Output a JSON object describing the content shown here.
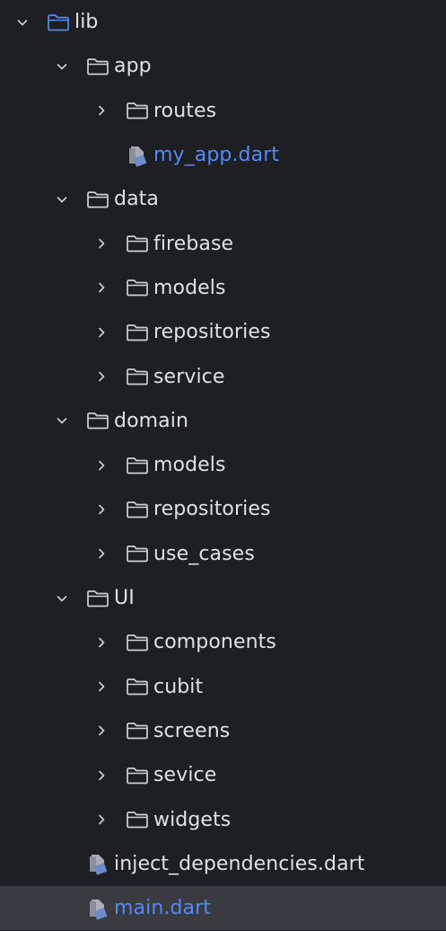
{
  "colors": {
    "background": "#1e1f22",
    "text": "#dfe1e5",
    "accent_blue": "#548af7",
    "folder_outline": "#ced0d6",
    "selected_row": "#393b40",
    "dart_icon": "#6c8cc8"
  },
  "tree": {
    "rows": [
      {
        "label": "lib",
        "type": "folder",
        "expanded": true,
        "depth": 0,
        "icon": "folder-icon",
        "highlight": true
      },
      {
        "label": "app",
        "type": "folder",
        "expanded": true,
        "depth": 1,
        "icon": "folder-icon"
      },
      {
        "label": "routes",
        "type": "folder",
        "expanded": false,
        "depth": 2,
        "icon": "folder-icon"
      },
      {
        "label": "my_app.dart",
        "type": "file",
        "depth": 2,
        "icon": "dart-file-icon",
        "highlight": true
      },
      {
        "label": "data",
        "type": "folder",
        "expanded": true,
        "depth": 1,
        "icon": "folder-icon"
      },
      {
        "label": "firebase",
        "type": "folder",
        "expanded": false,
        "depth": 2,
        "icon": "folder-icon"
      },
      {
        "label": "models",
        "type": "folder",
        "expanded": false,
        "depth": 2,
        "icon": "folder-icon"
      },
      {
        "label": "repositories",
        "type": "folder",
        "expanded": false,
        "depth": 2,
        "icon": "folder-icon"
      },
      {
        "label": "service",
        "type": "folder",
        "expanded": false,
        "depth": 2,
        "icon": "folder-icon"
      },
      {
        "label": "domain",
        "type": "folder",
        "expanded": true,
        "depth": 1,
        "icon": "folder-icon"
      },
      {
        "label": "models",
        "type": "folder",
        "expanded": false,
        "depth": 2,
        "icon": "folder-icon"
      },
      {
        "label": "repositories",
        "type": "folder",
        "expanded": false,
        "depth": 2,
        "icon": "folder-icon"
      },
      {
        "label": "use_cases",
        "type": "folder",
        "expanded": false,
        "depth": 2,
        "icon": "folder-icon"
      },
      {
        "label": "UI",
        "type": "folder",
        "expanded": true,
        "depth": 1,
        "icon": "folder-icon"
      },
      {
        "label": "components",
        "type": "folder",
        "expanded": false,
        "depth": 2,
        "icon": "folder-icon"
      },
      {
        "label": "cubit",
        "type": "folder",
        "expanded": false,
        "depth": 2,
        "icon": "folder-icon"
      },
      {
        "label": "screens",
        "type": "folder",
        "expanded": false,
        "depth": 2,
        "icon": "folder-icon"
      },
      {
        "label": "sevice",
        "type": "folder",
        "expanded": false,
        "depth": 2,
        "icon": "folder-icon"
      },
      {
        "label": "widgets",
        "type": "folder",
        "expanded": false,
        "depth": 2,
        "icon": "folder-icon"
      },
      {
        "label": "inject_dependencies.dart",
        "type": "file",
        "depth": 1,
        "icon": "dart-file-icon"
      },
      {
        "label": "main.dart",
        "type": "file",
        "depth": 1,
        "icon": "dart-file-icon",
        "highlight": true,
        "selected": true
      }
    ]
  }
}
